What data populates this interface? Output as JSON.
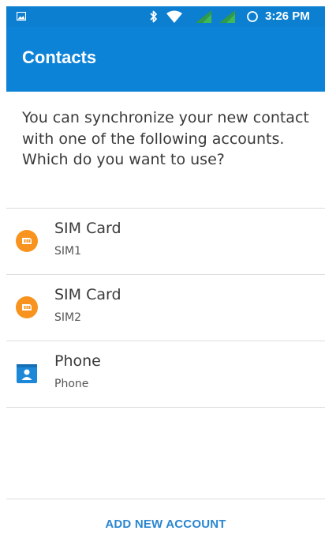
{
  "status_bar": {
    "time": "3:26 PM",
    "background_color": "#0c7fd0",
    "icons": [
      "image-icon",
      "bluetooth-icon",
      "wifi-icon",
      "signal-icon",
      "signal-icon",
      "sync-icon"
    ]
  },
  "app_bar": {
    "title": "Contacts",
    "background_color": "#0d83d8"
  },
  "dialog": {
    "message": "You can synchronize your new contact with one of the following accounts. Which do you want to use?",
    "accounts": [
      {
        "name": "SIM Card",
        "subtitle": "SIM1",
        "icon": "sim-card-icon",
        "icon_color": "#f7931e"
      },
      {
        "name": "SIM Card",
        "subtitle": "SIM2",
        "icon": "sim-card-icon",
        "icon_color": "#f7931e"
      },
      {
        "name": "Phone",
        "subtitle": "Phone",
        "icon": "phone-contact-icon",
        "icon_color": "#1e88d8"
      }
    ],
    "add_account_label": "ADD NEW ACCOUNT",
    "accent_color": "#2a86d0"
  }
}
